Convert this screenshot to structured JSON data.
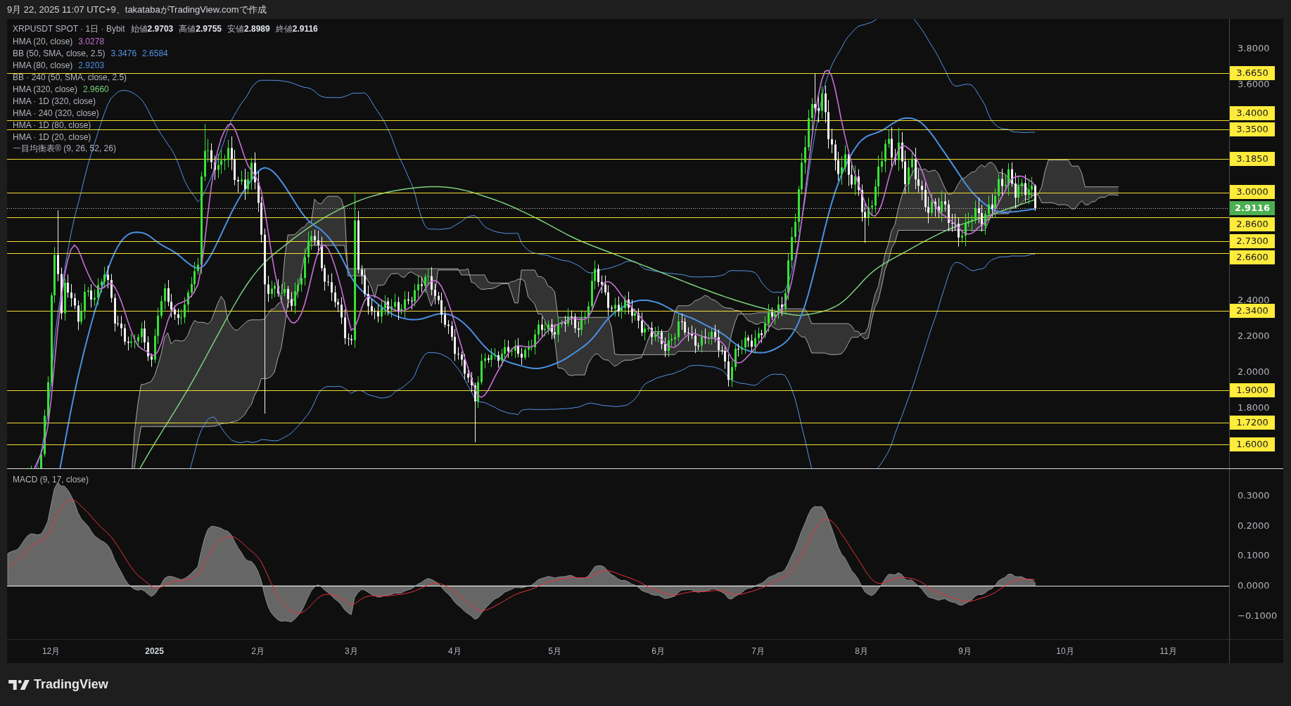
{
  "header": {
    "caption": "9月 22, 2025 11:07 UTC+9、takatabaがTradingView.comで作成"
  },
  "main_pane": {
    "legend": {
      "symbol": "XRPUSDT SPOT · 1日 · Bybit",
      "ohlc": [
        "始値**2.9703**",
        "高値**2.9755**",
        "安値**2.8989**",
        "終値**2.9116**"
      ],
      "indicators": [
        {
          "name": "HMA (20, close)",
          "values": [
            {
              "text": "3.0278",
              "color": "#c670d4"
            }
          ]
        },
        {
          "name": "BB (50, SMA, close, 2.5)",
          "values": [
            {
              "text": "3.3476",
              "color": "#5594e8"
            },
            {
              "text": "2.6584",
              "color": "#5594e8"
            }
          ]
        },
        {
          "name": "HMA (80, close)",
          "values": [
            {
              "text": "2.9203",
              "color": "#4a90e2"
            }
          ]
        },
        {
          "name": "BB · 240 (50, SMA, close, 2.5)"
        },
        {
          "name": "HMA (320, close)",
          "values": [
            {
              "text": "2.9660",
              "color": "#7ccf7c"
            }
          ]
        },
        {
          "name": "HMA · 1D (320, close)"
        },
        {
          "name": "HMA · 240 (320, close)"
        },
        {
          "name": "HMA · 1D (80, close)"
        },
        {
          "name": "HMA · 1D (20, close)"
        },
        {
          "name": "一目均衡表® (9, 26, 52, 26)"
        }
      ]
    },
    "price_scale": [
      "3.8000",
      "3.6000",
      "2.4000",
      "2.2000",
      "2.0000",
      "1.8000"
    ],
    "price_lines": [
      "3.6650",
      "3.4000",
      "3.3500",
      "3.1850",
      "3.0000",
      "2.8600",
      "2.7300",
      "2.6600",
      "2.3400",
      "1.9000",
      "1.7200",
      "1.6000"
    ],
    "last_price": "2.9116"
  },
  "macd_pane": {
    "title": "MACD (9, 17, close)",
    "scale": [
      "0.3000",
      "0.2000",
      "0.1000",
      "0.0000",
      "−0.1000"
    ]
  },
  "time_axis": [
    {
      "text": "12月",
      "kind": "month"
    },
    {
      "text": "2025",
      "kind": "year"
    },
    {
      "text": "2月",
      "kind": "month"
    },
    {
      "text": "3月",
      "kind": "month"
    },
    {
      "text": "4月",
      "kind": "month"
    },
    {
      "text": "5月",
      "kind": "month"
    },
    {
      "text": "6月",
      "kind": "month"
    },
    {
      "text": "7月",
      "kind": "month"
    },
    {
      "text": "8月",
      "kind": "month"
    },
    {
      "text": "9月",
      "kind": "month"
    },
    {
      "text": "10月",
      "kind": "month"
    },
    {
      "text": "11月",
      "kind": "month"
    }
  ],
  "footer": {
    "brand": "TradingView"
  }
}
